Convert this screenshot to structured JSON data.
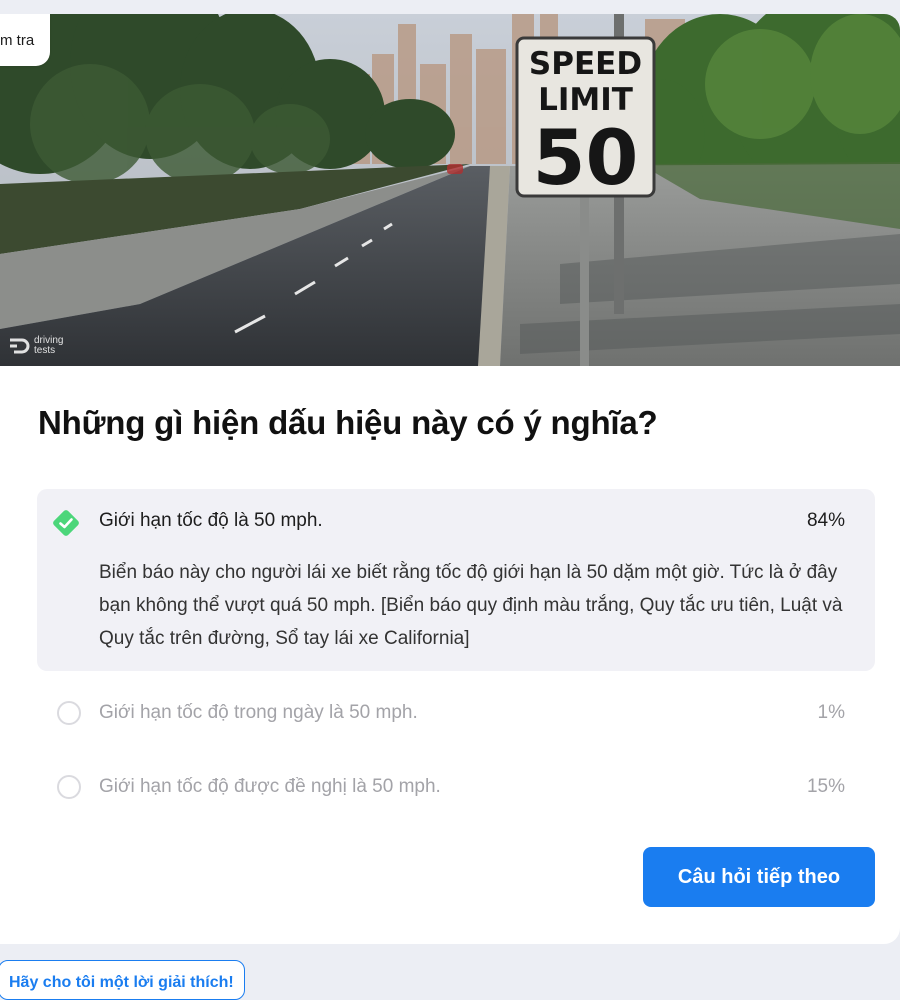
{
  "nav": {
    "back_label": "m tra"
  },
  "hero": {
    "sign_line1": "SPEED",
    "sign_line2": "LIMIT",
    "sign_number": "50",
    "watermark_line1": "driving",
    "watermark_line2": "tests"
  },
  "question": {
    "title": "Những gì hiện dấu hiệu này có ý nghĩa?"
  },
  "answers": [
    {
      "text": "Giới hạn tốc độ là 50 mph.",
      "percent": "84%",
      "correct": true,
      "explanation": "Biển báo này cho người lái xe biết rằng tốc độ giới hạn là 50 dặm một giờ. Tức là ở đây bạn không thể vượt quá 50 mph. [Biển báo quy định màu trắng, Quy tắc ưu tiên, Luật và Quy tắc trên đường, Sổ tay lái xe California]"
    },
    {
      "text": "Giới hạn tốc độ trong ngày là 50 mph.",
      "percent": "1%",
      "correct": false
    },
    {
      "text": "Giới hạn tốc độ được đề nghị là 50 mph.",
      "percent": "15%",
      "correct": false
    }
  ],
  "actions": {
    "next_label": "Câu hỏi tiếp theo",
    "explain_label": "Hãy cho tôi một lời giải thích!"
  },
  "colors": {
    "accent": "#1a7df0",
    "correct_green": "#4cd67a",
    "correct_bg": "#f1f1f6"
  }
}
